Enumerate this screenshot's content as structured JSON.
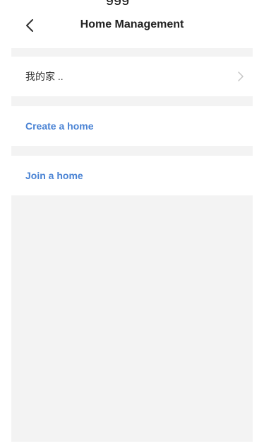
{
  "header": {
    "title": "Home Management",
    "back_icon": "chevron-left-icon"
  },
  "homes": [
    {
      "name": "我的家 ..",
      "icon": "chevron-right-icon"
    }
  ],
  "actions": {
    "create_label": "Create a home",
    "join_label": "Join a home"
  },
  "colors": {
    "link": "#4a83d4",
    "background": "#f3f3f3",
    "card": "#ffffff"
  }
}
